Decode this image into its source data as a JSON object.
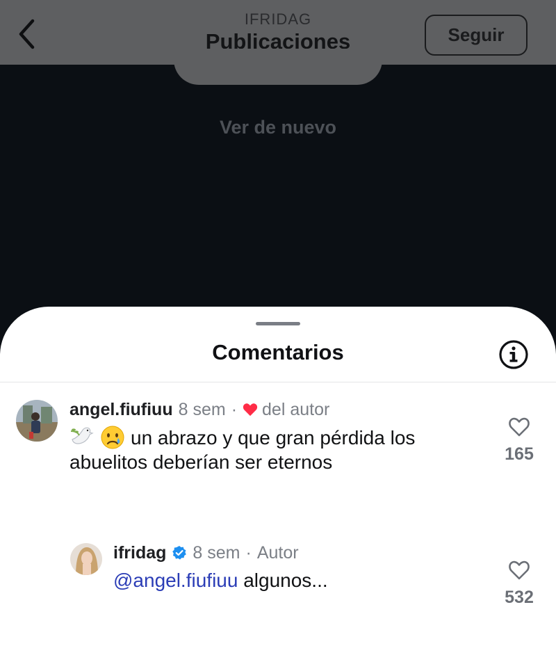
{
  "header": {
    "account": "IFRIDAG",
    "title": "Publicaciones",
    "follow_label": "Seguir"
  },
  "video": {
    "replay_label": "Ver de nuevo"
  },
  "comments_sheet": {
    "title": "Comentarios",
    "comments": [
      {
        "username": "angel.fiufiuu",
        "time": "8 sem",
        "separator": "·",
        "liked_by_author": "del autor",
        "emojis": [
          "dove-emoji",
          "crying-face-emoji"
        ],
        "text_line1": "un abrazo y que gran pérdida los",
        "text_line2": "abuelitos deberían ser eternos",
        "likes": "165"
      },
      {
        "username": "ifridag",
        "verified": true,
        "time": "8 sem",
        "separator": "·",
        "role": "Autor",
        "mention": "@angel.fiufiuu",
        "text": "algunos...",
        "likes": "532"
      }
    ]
  },
  "colors": {
    "accent_blue": "#2b3db6",
    "heart_red": "#ff2c47",
    "verified_blue": "#1d8ff0"
  }
}
